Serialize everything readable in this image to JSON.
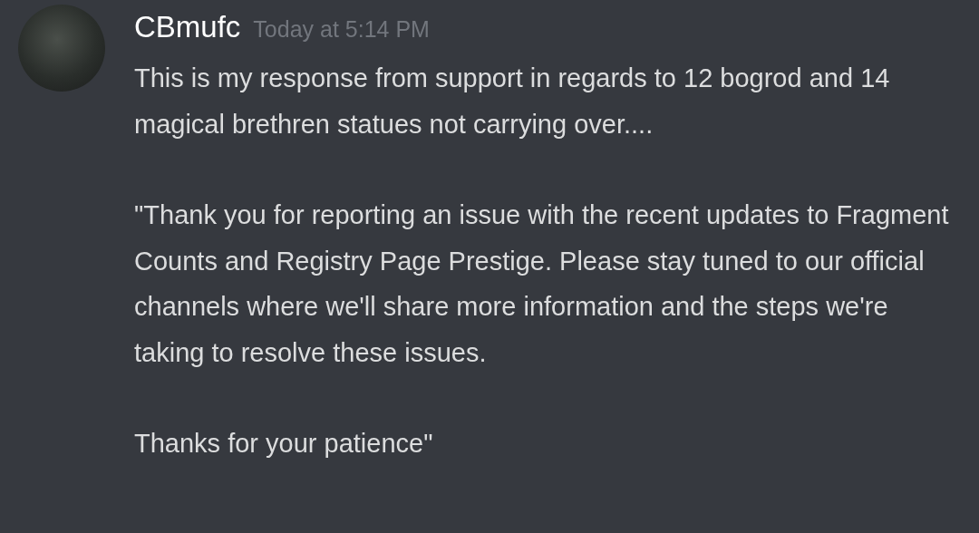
{
  "message": {
    "author": "CBmufc",
    "timestamp": "Today at 5:14 PM",
    "paragraphs": [
      "This is my response from support in regards to 12 bogrod and 14 magical brethren statues not carrying over....",
      "\"Thank you for reporting an issue with the recent updates to Fragment Counts and Registry Page Prestige. Please stay tuned to our official channels where we'll share more information and the steps we're taking to resolve these issues.",
      "Thanks for your patience\""
    ]
  }
}
